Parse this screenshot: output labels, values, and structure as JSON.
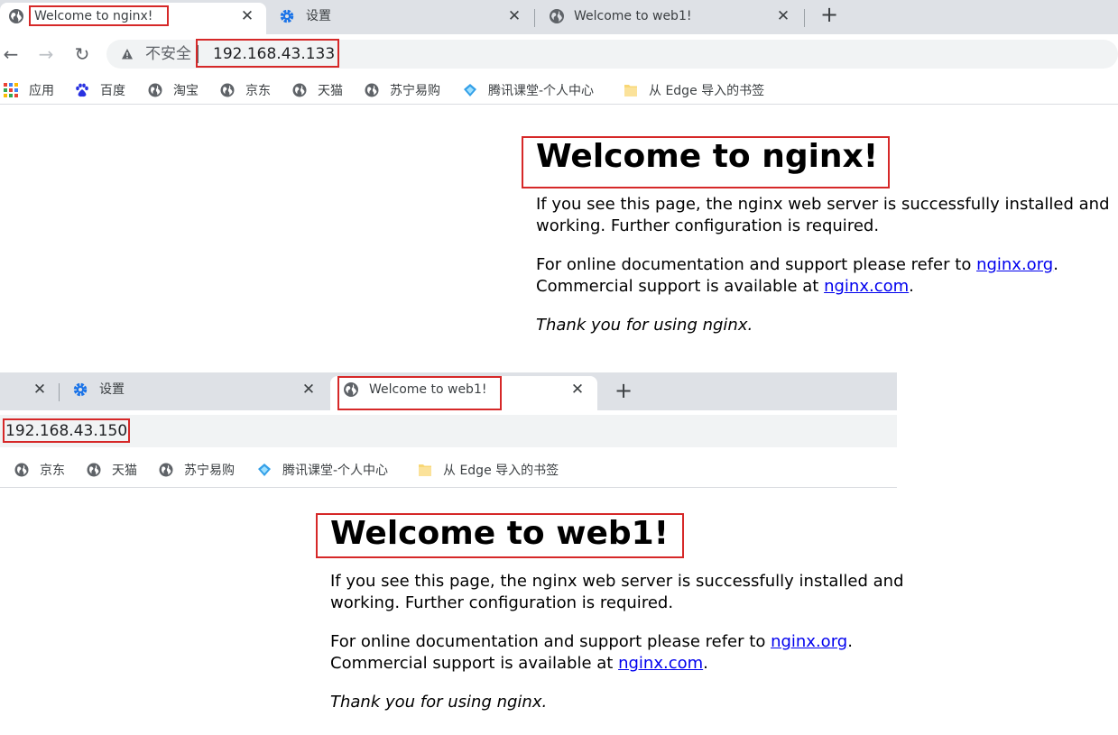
{
  "window1": {
    "tabs": [
      {
        "title": "Welcome to nginx!",
        "icon": "globe-icon",
        "active": true
      },
      {
        "title": "设置",
        "icon": "gear-icon",
        "active": false
      },
      {
        "title": "Welcome to web1!",
        "icon": "globe-icon",
        "active": false
      }
    ],
    "security_label": "不安全",
    "url": "192.168.43.133",
    "bookmarks": [
      {
        "label": "应用",
        "icon": "apps-grid-icon"
      },
      {
        "label": "百度",
        "icon": "baidu-paw-icon"
      },
      {
        "label": "淘宝",
        "icon": "globe-icon"
      },
      {
        "label": "京东",
        "icon": "globe-icon"
      },
      {
        "label": "天猫",
        "icon": "globe-icon"
      },
      {
        "label": "苏宁易购",
        "icon": "globe-icon"
      },
      {
        "label": "腾讯课堂-个人中心",
        "icon": "tencent-classroom-icon"
      },
      {
        "label": "从 Edge 导入的书签",
        "icon": "folder-icon"
      }
    ],
    "page": {
      "heading": "Welcome to nginx!",
      "para1": "If you see this page, the nginx web server is successfully installed and",
      "para1b": "working. Further configuration is required.",
      "para2a": "For online documentation and support please refer to ",
      "link1": "nginx.org",
      "para2b": ".",
      "para2c": "Commercial support is available at ",
      "link2": "nginx.com",
      "para2d": ".",
      "thanks": "Thank you for using nginx."
    }
  },
  "window2": {
    "tabs": [
      {
        "title": "",
        "icon": "",
        "active": false
      },
      {
        "title": "设置",
        "icon": "gear-icon",
        "active": false
      },
      {
        "title": "Welcome to web1!",
        "icon": "globe-icon",
        "active": true
      }
    ],
    "url": "192.168.43.150",
    "bookmarks": [
      {
        "label": "京东",
        "icon": "globe-icon"
      },
      {
        "label": "天猫",
        "icon": "globe-icon"
      },
      {
        "label": "苏宁易购",
        "icon": "globe-icon"
      },
      {
        "label": "腾讯课堂-个人中心",
        "icon": "tencent-classroom-icon"
      },
      {
        "label": "从 Edge 导入的书签",
        "icon": "folder-icon"
      }
    ],
    "page": {
      "heading": "Welcome to web1!",
      "para1": "If you see this page, the nginx web server is successfully installed and",
      "para1b": "working. Further configuration is required.",
      "para2a": "For online documentation and support please refer to ",
      "link1": "nginx.org",
      "para2b": ".",
      "para2c": "Commercial support is available at ",
      "link2": "nginx.com",
      "para2d": ".",
      "thanks": "Thank you for using nginx."
    }
  },
  "colors": {
    "highlight": "#d62828",
    "tabstrip": "#dee1e6",
    "link": "#0000ee",
    "gear_blue": "#1a73e8"
  }
}
